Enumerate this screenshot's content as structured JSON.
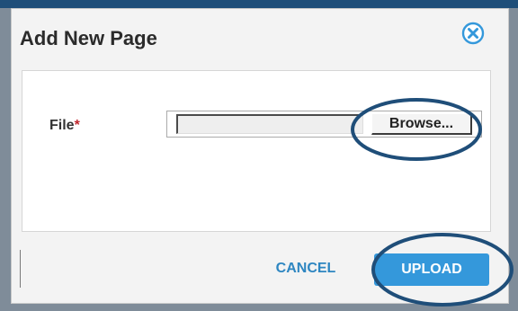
{
  "dialog": {
    "title": "Add New Page",
    "close_icon": "close-circle-icon"
  },
  "form": {
    "file_label": "File",
    "required_marker": "*",
    "file_value": "",
    "browse_label": "Browse..."
  },
  "footer": {
    "cancel_label": "CANCEL",
    "upload_label": "UPLOAD"
  },
  "colors": {
    "accent": "#3498db",
    "link": "#2e86c1",
    "required": "#c0262d",
    "highlight_ellipse": "#1f4e79"
  }
}
